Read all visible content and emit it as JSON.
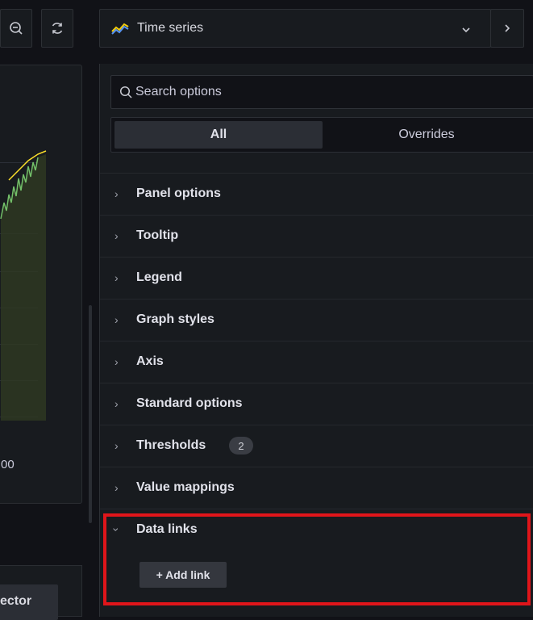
{
  "toolbar": {
    "zoom_out_icon": "zoom-out-icon",
    "refresh_icon": "refresh-icon"
  },
  "viz_picker": {
    "title": "Time series",
    "icon": "time-series-icon"
  },
  "preview": {
    "tick_label": "00",
    "query_button_label": "ector",
    "series_colors": [
      "#73bf69",
      "#fade2a"
    ]
  },
  "options": {
    "search_placeholder": "Search options",
    "tabs": [
      "All",
      "Overrides"
    ],
    "active_tab": "All",
    "sections": [
      {
        "label": "Panel options",
        "expanded": false
      },
      {
        "label": "Tooltip",
        "expanded": false
      },
      {
        "label": "Legend",
        "expanded": false
      },
      {
        "label": "Graph styles",
        "expanded": false
      },
      {
        "label": "Axis",
        "expanded": false
      },
      {
        "label": "Standard options",
        "expanded": false
      },
      {
        "label": "Thresholds",
        "expanded": false,
        "badge": "2"
      },
      {
        "label": "Value mappings",
        "expanded": false
      },
      {
        "label": "Data links",
        "expanded": true
      }
    ],
    "add_link_label": "+ Add link"
  },
  "colors": {
    "highlight": "#e0151a",
    "background": "#111217",
    "panel": "#181b1f"
  }
}
